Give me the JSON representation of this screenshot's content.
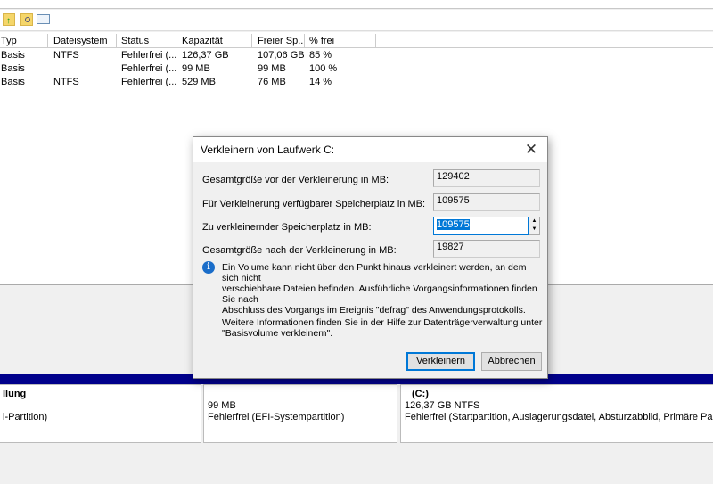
{
  "toolbar": {
    "icons": [
      "folder-up-icon",
      "folder-search-icon",
      "properties-icon"
    ]
  },
  "table": {
    "headers": [
      "Typ",
      "Dateisystem",
      "Status",
      "Kapazität",
      "Freier Sp...",
      "% frei"
    ],
    "rows": [
      [
        "Basis",
        "NTFS",
        "Fehlerfrei (...",
        "126,37 GB",
        "107,06 GB",
        "85 %"
      ],
      [
        "Basis",
        "",
        "Fehlerfrei (...",
        "99 MB",
        "99 MB",
        "100 %"
      ],
      [
        "Basis",
        "NTFS",
        "Fehlerfrei (...",
        "529 MB",
        "76 MB",
        "14 %"
      ]
    ]
  },
  "partitions": [
    {
      "title": "llung",
      "size": "",
      "status": "l-Partition)"
    },
    {
      "title": "",
      "size": "99 MB",
      "status": "Fehlerfrei (EFI-Systempartition)"
    },
    {
      "title": "(C:)",
      "size": "126,37 GB NTFS",
      "status": "Fehlerfrei (Startpartition, Auslagerungsdatei, Absturzabbild, Primäre Partition)"
    }
  ],
  "dialog": {
    "title": "Verkleinern von Laufwerk C:",
    "fields": [
      {
        "label": "Gesamtgröße vor der Verkleinerung in MB:",
        "value": "129402"
      },
      {
        "label": "Für Verkleinerung verfügbarer Speicherplatz in MB:",
        "value": "109575"
      },
      {
        "label": "Zu verkleinernder Speicherplatz in MB:",
        "value": "109575"
      },
      {
        "label": "Gesamtgröße nach der Verkleinerung in MB:",
        "value": "19827"
      }
    ],
    "info_lines": [
      "Ein Volume kann nicht über den Punkt hinaus verkleinert werden, an dem sich nicht",
      "verschiebbare Dateien befinden. Ausführliche Vorgangsinformationen finden Sie nach",
      "Abschluss des Vorgangs im Ereignis \"defrag\" des Anwendungsprotokolls."
    ],
    "help_lines": [
      "Weitere Informationen finden Sie in der Hilfe zur Datenträgerverwaltung unter",
      "\"Basisvolume verkleinern\"."
    ],
    "ok_label": "Verkleinern",
    "cancel_label": "Abbrechen"
  }
}
